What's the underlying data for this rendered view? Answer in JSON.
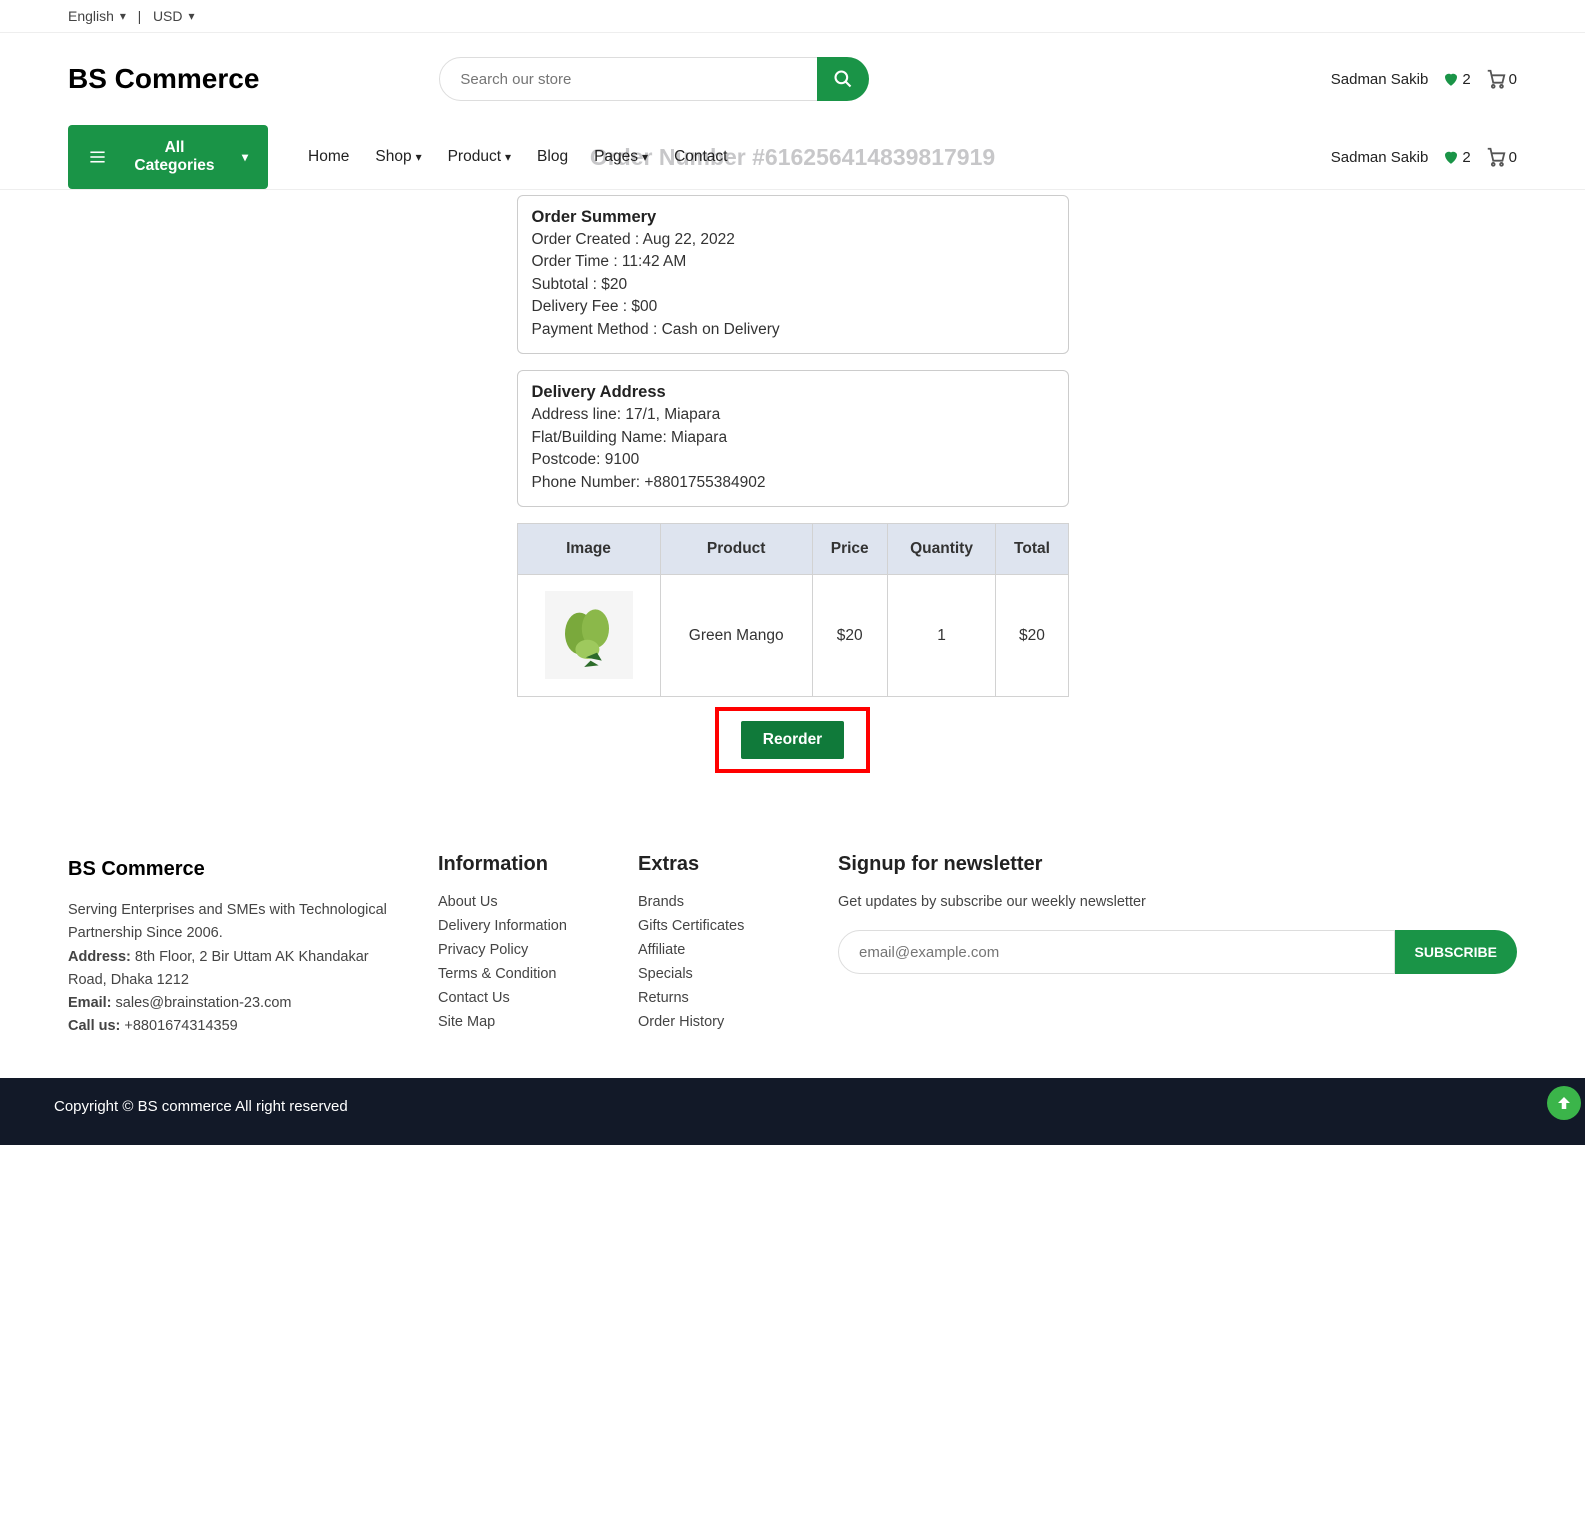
{
  "topbar": {
    "language": "English",
    "currency": "USD",
    "separator": "|"
  },
  "brand": "BS Commerce",
  "search": {
    "placeholder": "Search our store"
  },
  "user": {
    "name": "Sadman Sakib",
    "wishlist_count": "2",
    "cart_count": "0"
  },
  "allCategories": "All Categories",
  "nav": {
    "home": "Home",
    "shop": "Shop",
    "product": "Product",
    "blog": "Blog",
    "pages": "Pages",
    "contact": "Contact"
  },
  "sticky_user": {
    "name": "Sadman Sakib",
    "wishlist_count": "2",
    "cart_count": "0"
  },
  "pageTitle": "Order Number #616256414839817919",
  "summary": {
    "title": "Order Summery",
    "created": "Order Created : Aug 22, 2022",
    "time": "Order Time : 11:42 AM",
    "subtotal": "Subtotal : $20",
    "delivery_fee": "Delivery Fee : $00",
    "payment": "Payment Method : Cash on Delivery"
  },
  "delivery": {
    "title": "Delivery Address",
    "address": "Address line: 17/1, Miapara",
    "flat": "Flat/Building Name: Miapara",
    "postcode": "Postcode: 9100",
    "phone": "Phone Number: +8801755384902"
  },
  "table": {
    "headers": {
      "image": "Image",
      "product": "Product",
      "price": "Price",
      "quantity": "Quantity",
      "total": "Total"
    },
    "rows": [
      {
        "product": "Green Mango",
        "price": "$20",
        "quantity": "1",
        "total": "$20"
      }
    ]
  },
  "reorder": "Reorder",
  "footer": {
    "brand": "BS Commerce",
    "desc": "Serving Enterprises and SMEs with Technological Partnership Since 2006.",
    "address_label": "Address:",
    "address": " 8th Floor, 2 Bir Uttam AK Khandakar Road, Dhaka 1212",
    "email_label": "Email:",
    "email": " sales@brainstation-23.com",
    "callus_label": "Call us:",
    "callus": " +8801674314359",
    "info_title": "Information",
    "info_links": {
      "about": "About Us",
      "delivery": "Delivery Information",
      "privacy": "Privacy Policy",
      "terms": "Terms & Condition",
      "contact": "Contact Us",
      "sitemap": "Site Map"
    },
    "extras_title": "Extras",
    "extras_links": {
      "brands": "Brands",
      "gifts": "Gifts Certificates",
      "affiliate": "Affiliate",
      "specials": "Specials",
      "returns": "Returns",
      "history": "Order History"
    },
    "news_title": "Signup for newsletter",
    "news_desc": "Get updates by subscribe our weekly newsletter",
    "news_placeholder": "email@example.com",
    "subscribe": "SUBSCRIBE"
  },
  "copyright": "Copyright © BS commerce All right reserved"
}
